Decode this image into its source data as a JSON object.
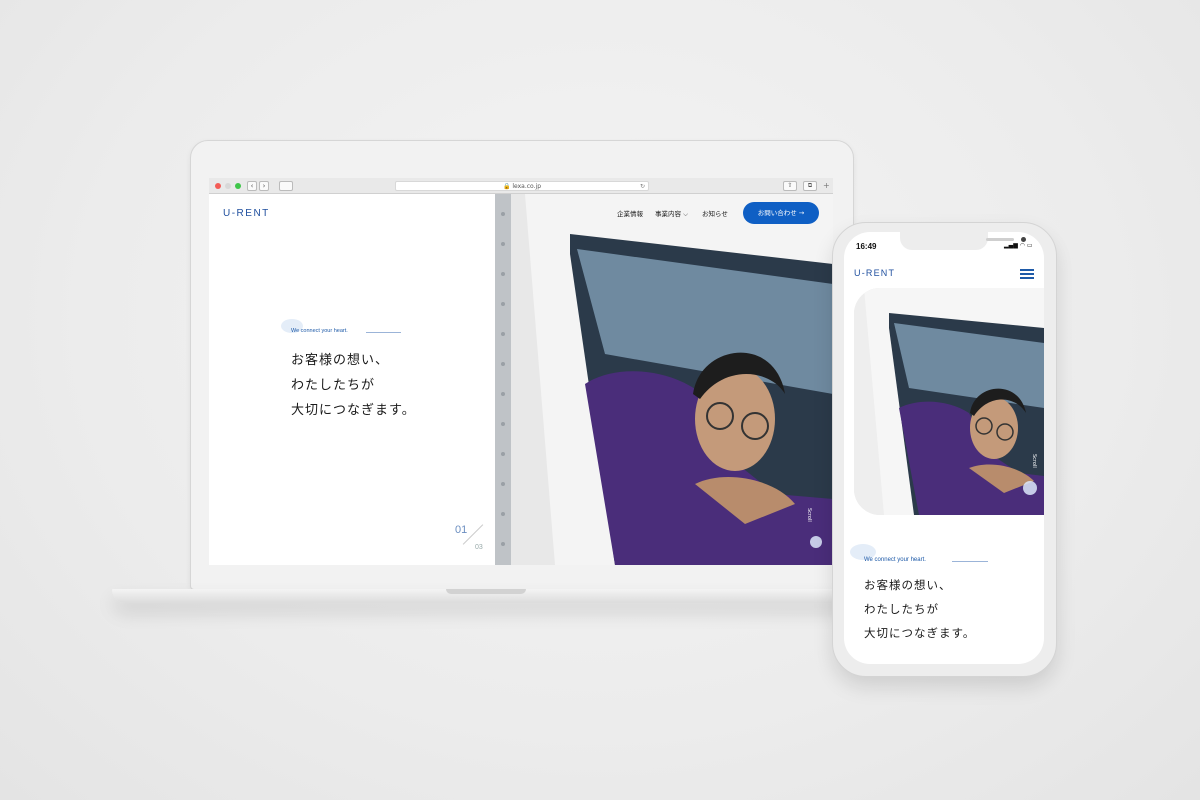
{
  "browser": {
    "url": "🔒 lexa.co.jp",
    "back_glyph": "‹",
    "forward_glyph": "›",
    "reload_glyph": "↻",
    "share_glyph": "⇧",
    "tabs_glyph": "⧉",
    "new_tab_glyph": "+"
  },
  "site": {
    "logo": "U-RENT",
    "nav": [
      {
        "label": "企業情報"
      },
      {
        "label": "事業内容 ⌵"
      },
      {
        "label": "お知らせ"
      }
    ],
    "contact_label": "お問い合わせ  →",
    "tagline": "We connect your heart.",
    "headline": [
      "お客様の想い、",
      "わたしたちが",
      "大切につなぎます。"
    ],
    "slide_current": "01",
    "slide_total": "03",
    "scroll_label": "Scroll"
  },
  "phone": {
    "time": "16:49",
    "status_icons": "▂▄▆ ◠ ▭"
  },
  "colors": {
    "brand": "#1e4e9e",
    "button": "#0f5fc4",
    "accent_line": "#9bb4d8"
  }
}
